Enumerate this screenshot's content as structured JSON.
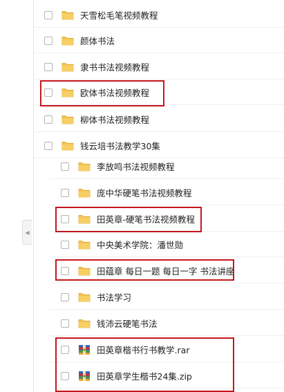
{
  "items": [
    {
      "name": "天雪松毛笔视频教程",
      "icon": "folder-icon"
    },
    {
      "name": "颜体书法",
      "icon": "folder-icon"
    },
    {
      "name": "隶书书法视频教程",
      "icon": "folder-icon"
    },
    {
      "name": "欧体书法视频教程",
      "icon": "folder-icon"
    },
    {
      "name": "柳体书法视频教程",
      "icon": "folder-icon"
    },
    {
      "name": "钱云培书法教学30集",
      "icon": "folder-icon"
    },
    {
      "name": "李放鸣书法视频教程",
      "icon": "folder-icon"
    },
    {
      "name": "庞中华硬笔书法视频教程",
      "icon": "folder-icon"
    },
    {
      "name": "田英章-硬笔书法视频教程",
      "icon": "folder-icon"
    },
    {
      "name": "中央美术学院：潘世勋",
      "icon": "folder-icon"
    },
    {
      "name": "田蕴章 每日一题 每日一字 书法讲座",
      "icon": "folder-icon"
    },
    {
      "name": "书法学习",
      "icon": "folder-icon"
    },
    {
      "name": "钱沛云硬笔书法",
      "icon": "folder-icon"
    },
    {
      "name": "田英章楷书行书教学.rar",
      "icon": "archive-icon"
    },
    {
      "name": "田英章学生楷书24集.zip",
      "icon": "archive-icon"
    }
  ],
  "colors": {
    "folder": "#f2c14e",
    "highlight": "#c4161c"
  },
  "icons": {
    "collapse": "chevron-left-icon"
  }
}
